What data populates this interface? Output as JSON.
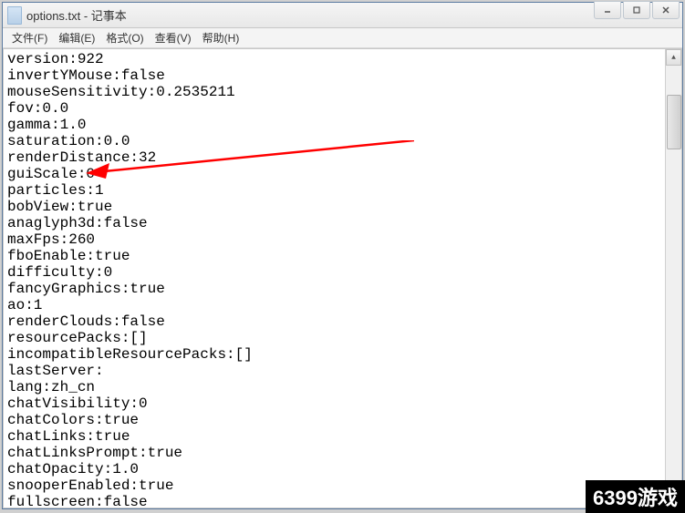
{
  "window": {
    "title": "options.txt - 记事本"
  },
  "menubar": {
    "file": "文件(F)",
    "edit": "编辑(E)",
    "format": "格式(O)",
    "view": "查看(V)",
    "help": "帮助(H)"
  },
  "content": {
    "lines": [
      "version:922",
      "invertYMouse:false",
      "mouseSensitivity:0.2535211",
      "fov:0.0",
      "gamma:1.0",
      "saturation:0.0",
      "renderDistance:32",
      "guiScale:0",
      "particles:1",
      "bobView:true",
      "anaglyph3d:false",
      "maxFps:260",
      "fboEnable:true",
      "difficulty:0",
      "fancyGraphics:true",
      "ao:1",
      "renderClouds:false",
      "resourcePacks:[]",
      "incompatibleResourcePacks:[]",
      "lastServer:",
      "lang:zh_cn",
      "chatVisibility:0",
      "chatColors:true",
      "chatLinks:true",
      "chatLinksPrompt:true",
      "chatOpacity:1.0",
      "snooperEnabled:true",
      "fullscreen:false"
    ]
  },
  "watermark": "6399游戏"
}
